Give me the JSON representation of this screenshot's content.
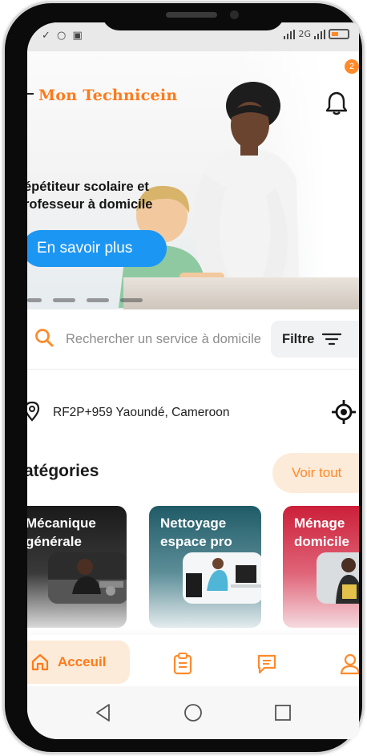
{
  "status_bar": {
    "left_icons": "✓ ○ ▣",
    "network": "2G",
    "battery_level": 0.3
  },
  "hero": {
    "brand": "Mon Technicein",
    "title_line1": "épétiteur scolaire et",
    "title_line2": "rofesseur à domicile",
    "cta_label": "En savoir plus",
    "notification_count": "2",
    "carousel_dots": 4
  },
  "search": {
    "placeholder": "Rechercher un service à domicile",
    "filter_label": "Filtre"
  },
  "location": {
    "address": "RF2P+959 Yaoundé, Cameroon"
  },
  "categories": {
    "title": "atégories",
    "see_all_label": "Voir tout",
    "items": [
      {
        "line1": "Mécanique",
        "line2": "générale"
      },
      {
        "line1": "Nettoyage",
        "line2": "espace pro"
      },
      {
        "line1": "Ménage",
        "line2": "domicile"
      }
    ]
  },
  "bottom_nav": {
    "home_label": "Acceuil"
  },
  "colors": {
    "accent": "#ff8a2a",
    "cta_blue": "#1c96f3",
    "accent_soft": "#fdebd9"
  },
  "icons": [
    "bell-icon",
    "search-icon",
    "filter-icon",
    "location-pin-icon",
    "gps-target-icon",
    "home-icon",
    "clipboard-icon",
    "chat-icon",
    "user-icon"
  ]
}
